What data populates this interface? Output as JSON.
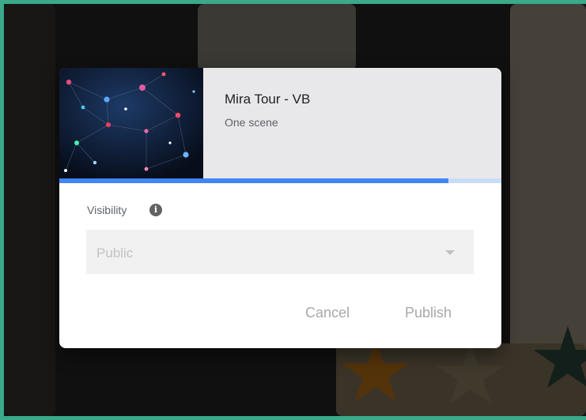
{
  "dialog": {
    "title": "Mira Tour - VB",
    "subtitle": "One scene",
    "progress_fraction": 0.88,
    "visibility_label": "Visibility",
    "info_icon": "info-icon",
    "visibility_select": {
      "selected": "Public",
      "caret_icon": "chevron-down-icon"
    },
    "cancel_label": "Cancel",
    "publish_label": "Publish"
  },
  "colors": {
    "accent": "#4285f4",
    "progress_track": "#c9dcf7",
    "frame_border": "#3ba98a"
  }
}
